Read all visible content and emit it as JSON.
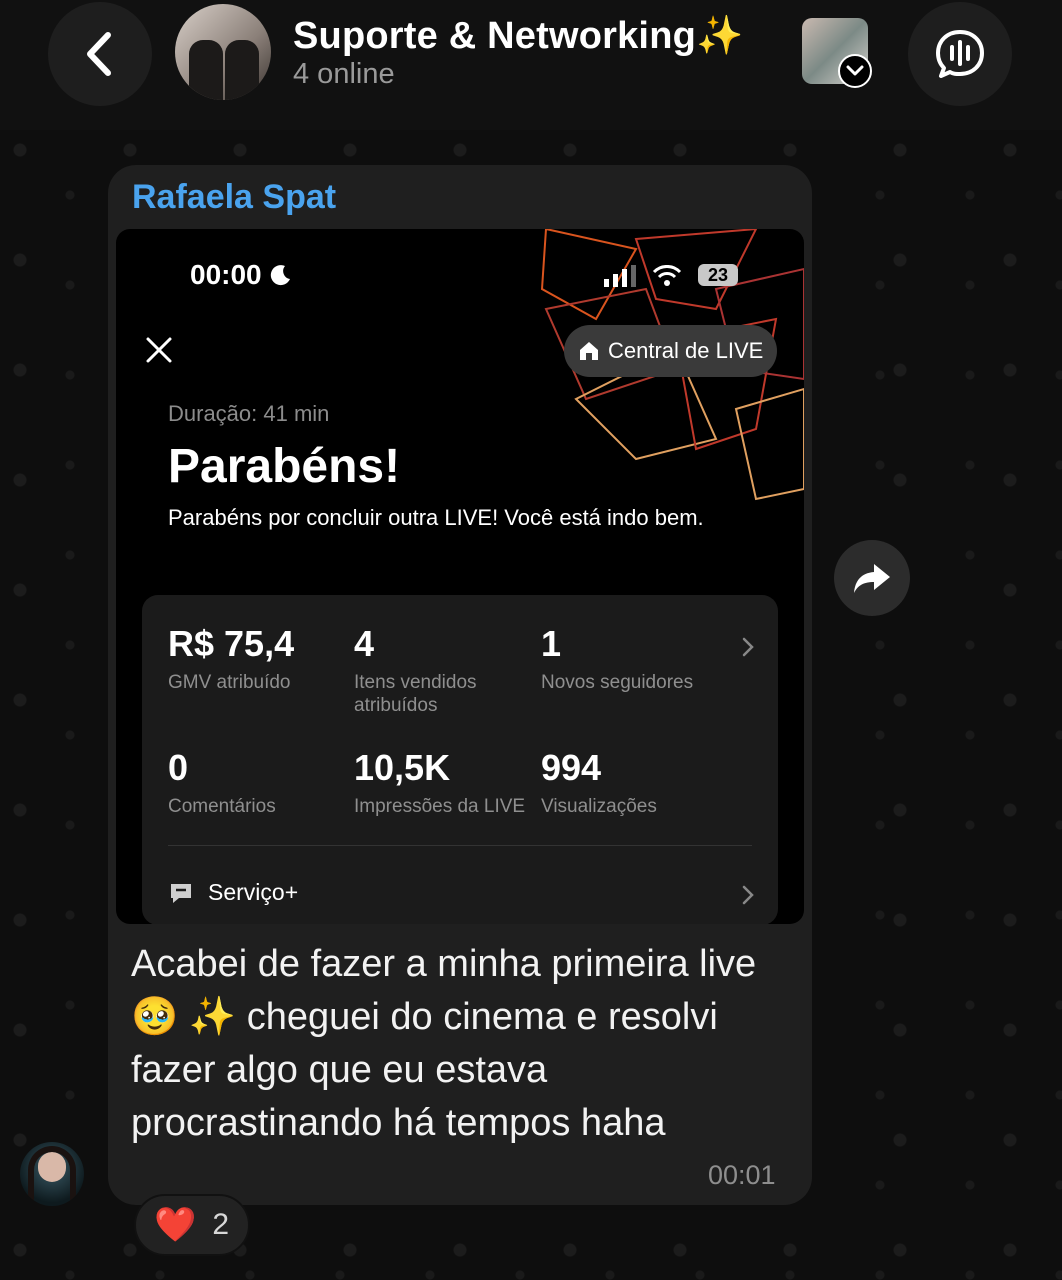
{
  "header": {
    "title": "Suporte & Networking✨",
    "subtitle": "4 online"
  },
  "message": {
    "sender": "Rafaela Spat",
    "text": "Acabei de fazer a minha primeira live 🥹 ✨ cheguei do cinema e resolvi fazer algo que eu estava procrastinando há tempos haha",
    "time": "00:01",
    "reaction": {
      "emoji": "❤️",
      "count": "2"
    }
  },
  "screenshot": {
    "status_time": "00:00",
    "battery": "23",
    "central_label": "Central de LIVE",
    "duration": "Duração: 41 min",
    "title": "Parabéns!",
    "text": "Parabéns por concluir outra LIVE! Você está indo bem.",
    "stats": [
      {
        "value": "R$ 75,4",
        "label": "GMV atribuído"
      },
      {
        "value": "4",
        "label": "Itens vendidos atribuídos"
      },
      {
        "value": "1",
        "label": "Novos seguidores"
      },
      {
        "value": "0",
        "label": "Comentários"
      },
      {
        "value": "10,5K",
        "label": "Impressões da LIVE"
      },
      {
        "value": "994",
        "label": "Visualizações"
      }
    ],
    "service_label": "Serviço+"
  },
  "colors": {
    "sender": "#4aa3ee",
    "bubble": "#1f1f1f",
    "accent_lines": "#c0392b"
  }
}
